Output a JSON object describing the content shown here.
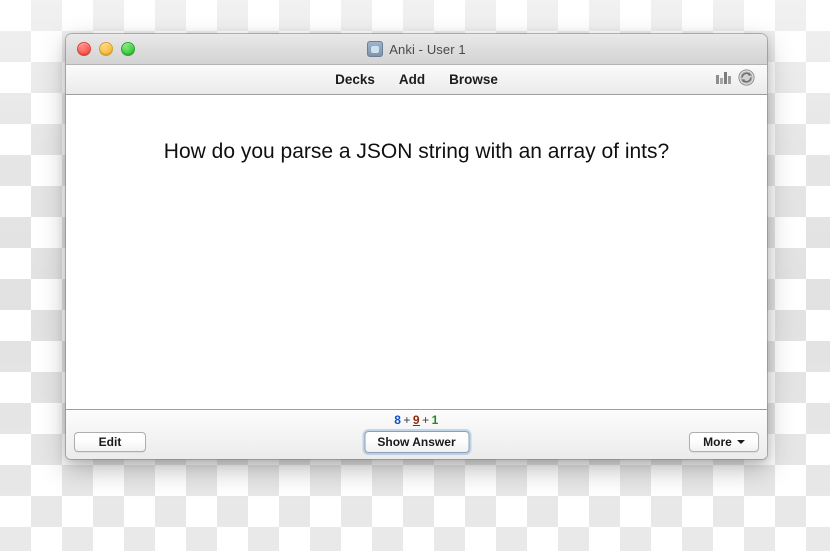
{
  "window": {
    "title": "Anki - User 1",
    "app_icon": "anki-app-icon",
    "traffic_lights": [
      {
        "name": "close",
        "color": "#f8554c"
      },
      {
        "name": "minimize",
        "color": "#f6bb3c"
      },
      {
        "name": "zoom",
        "color": "#35c93b"
      }
    ]
  },
  "toolbar": {
    "links": [
      {
        "name": "decks",
        "label": "Decks"
      },
      {
        "name": "add",
        "label": "Add"
      },
      {
        "name": "browse",
        "label": "Browse"
      }
    ],
    "right_icons": [
      {
        "name": "stats-icon",
        "title": "Stats"
      },
      {
        "name": "sync-icon",
        "title": "Sync"
      }
    ]
  },
  "card": {
    "question": "How do you parse a JSON string with an array of ints?"
  },
  "bottom": {
    "counts": {
      "new": "8",
      "learning": "9",
      "review": "1",
      "separator": "+",
      "colors": {
        "new": "#0f4ec9",
        "learning": "#8a2b10",
        "review": "#1d8c1d"
      }
    },
    "edit_label": "Edit",
    "show_answer_label": "Show Answer",
    "more_label": "More"
  }
}
